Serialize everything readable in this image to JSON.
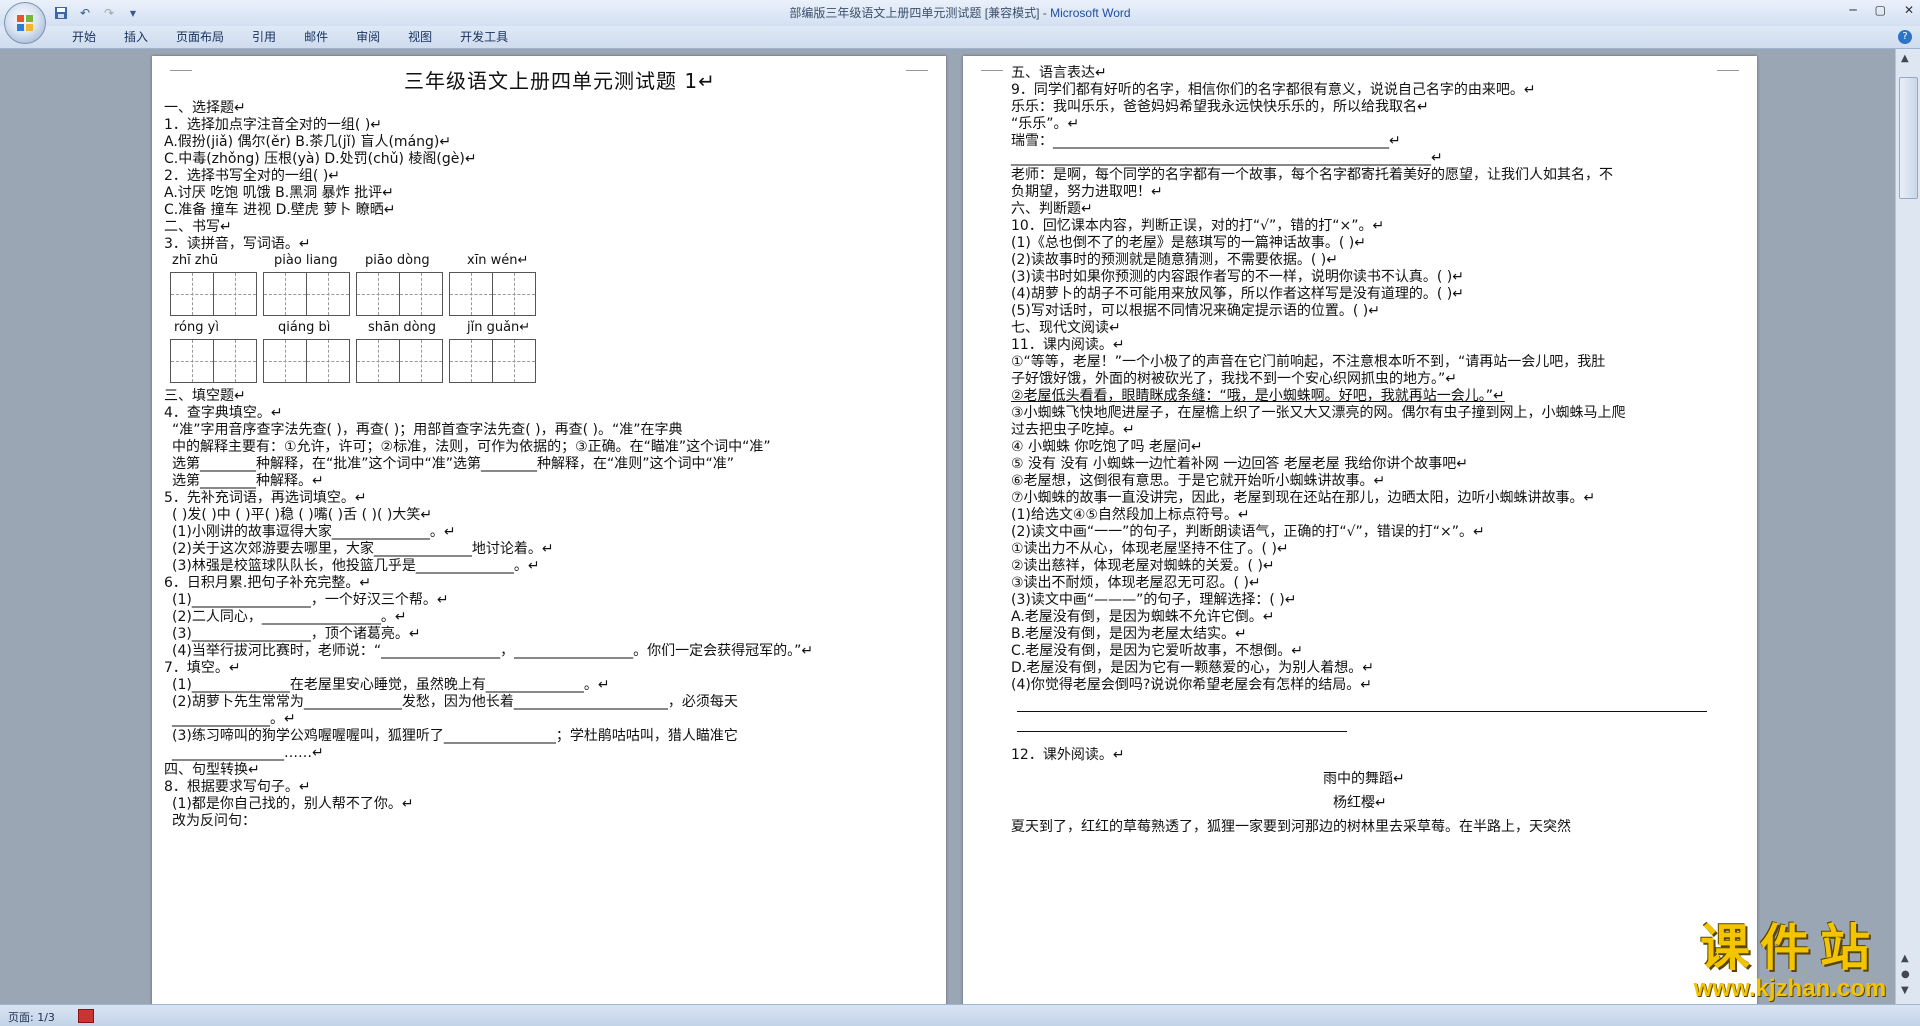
{
  "window": {
    "title": "部编版三年级语文上册四单元测试题 [兼容模式] - ",
    "app_name": "Microsoft Word",
    "qat_items": [
      "save-icon",
      "undo-icon",
      "redo-icon",
      "customize-icon"
    ]
  },
  "ribbon": {
    "tabs": [
      "开始",
      "插入",
      "页面布局",
      "引用",
      "邮件",
      "审阅",
      "视图",
      "开发工具"
    ]
  },
  "status": {
    "page_info": "页面: 1/3"
  },
  "watermark": {
    "text": "课件站",
    "url": "www.kjzhan.com"
  },
  "left_page": {
    "title": "三年级语文上册四单元测试题 1↵",
    "lines": [
      "一、选择题↵",
      "1．选择加点字注音全对的一组(  )↵",
      "A.假扮(jiǎ)     偶尔(ěr)     B.茶几(jǐ)     盲人(máng)↵",
      "C.中毒(zhǒng)   压根(yà)     D.处罚(chǔ)    棱阁(gè)↵",
      "2．选择书写全对的一组(  )↵",
      "A.讨厌   吃饱   叽饿      B.黑洞   暴炸   批评↵",
      "C.准备   撞车   进视      D.壁虎   萝卜   瞭晒↵",
      "二、书写↵",
      "3．读拼音，写词语。↵",
      "三、填空题↵",
      "4．查字典填空。↵",
      "“准”字用音序查字法先查(     )，再查(     )；用部首查字法先查(     )，再查(     )。“准”在字典",
      "中的解释主要有：①允许，许可；②标准，法则，可作为依据的；③正确。在“瞄准”这个词中“准”",
      "选第________种解释，在“批准”这个词中“准”选第________种解释，在“准则”这个词中“准”",
      "选第________种解释。↵",
      "5．先补充词语，再选词填空。↵",
      "(      )发(      )中      (      )平(      )稳      (      )嘴(      )舌      (      )(      )大笑↵",
      "(1)小刚讲的故事逗得大家______________。↵",
      "(2)关于这次郊游要去哪里，大家______________地讨论着。↵",
      "(3)林强是校篮球队队长，他投篮几乎是______________。↵",
      "6．日积月累.把句子补充完整。↵",
      "(1)_________________，一个好汉三个帮。↵",
      "(2)二人同心，_________________。↵",
      "(3)_________________，顶个诸葛亮。↵",
      "(4)当举行拔河比赛时，老师说：“_________________，_________________。你们一定会获得冠军的。”↵",
      "7．填空。↵",
      "(1)______________在老屋里安心睡觉，虽然晚上有______________。↵",
      "(2)胡萝卜先生常常为______________发愁，因为他长着______________________，必须每天",
      "______________。↵",
      "(3)练习啼叫的狗学公鸡喔喔喔叫，狐狸听了________________；学杜鹃咕咕叫，猎人瞄准它",
      "________________……↵",
      "四、句型转换↵",
      "8．根据要求写句子。↵",
      "(1)都是你自己找的，别人帮不了你。↵",
      "改为反问句："
    ],
    "pinyin_row1": [
      "zhī  zhū",
      "piào liang",
      "piāo dòng",
      "xīn  wén↵"
    ],
    "pinyin_row2": [
      "róng  yì",
      "qiáng  bì",
      "shān  dòng",
      "jǐn  guǎn↵"
    ]
  },
  "right_page": {
    "lines": [
      "五、语言表达↵",
      "9．同学们都有好听的名字，相信你们的名字都很有意义，说说自己名字的由来吧。↵",
      " 乐乐：我叫乐乐，爸爸妈妈希望我永远快快乐乐的，所以给我取名↵",
      " “乐乐”。↵",
      " 瑞雪：________________________________________________↵",
      "____________________________________________________________↵",
      " 老师：是啊，每个同学的名字都有一个故事，每个名字都寄托着美好的愿望，让我们人如其名，不",
      " 负期望，努力进取吧！↵",
      "六、判断题↵",
      "10．回忆课本内容，判断正误，对的打“√”，错的打“×”。↵",
      " (1)《总也倒不了的老屋》是慈琪写的一篇神话故事。(    )↵",
      " (2)读故事时的预测就是随意猜测，不需要依据。(      )↵",
      " (3)读书时如果你预测的内容跟作者写的不一样，说明你读书不认真。(    )↵",
      " (4)胡萝卜的胡子不可能用来放风筝，所以作者这样写是没有道理的。(    )↵",
      " (5)写对话时，可以根据不同情况来确定提示语的位置。(    )↵",
      "七、现代文阅读↵",
      "11．课内阅读。↵",
      "①“等等，老屋！”一个小极了的声音在它门前响起，不注意根本听不到，“请再站一会儿吧，我肚",
      "子好饿好饿，外面的树被砍光了，我找不到一个安心织网抓虫的地方。”↵",
      "②老屋低头看看，眼睛眯成条缝：“哦，是小蜘蛛啊。好吧，我就再站一会儿。”↵",
      "③小蜘蛛飞快地爬进屋子，在屋檐上织了一张又大又漂亮的网。偶尔有虫子撞到网上，小蜘蛛马上爬",
      "过去把虫子吃掉。↵",
      "④ 小蜘蛛   你吃饱了吗   老屋问↵",
      "⑤ 没有   没有   小蜘蛛一边忙着补网   一边回答  老屋老屋  我给你讲个故事吧↵",
      "⑥老屋想，这倒很有意思。于是它就开始听小蜘蛛讲故事。↵",
      "⑦小蜘蛛的故事一直没讲完，因此，老屋到现在还站在那儿，边晒太阳，边听小蜘蛛讲故事。↵",
      "(1)给选文④⑤自然段加上标点符号。↵",
      "(2)读文中画“一一”的句子，判断朗读语气，正确的打“√”，错误的打“×”。↵",
      "①读出力不从心，体现老屋坚持不住了。(      )↵",
      "②读出慈祥，体现老屋对蜘蛛的关爱。(    )↵",
      "③读出不耐烦，体现老屋忍无可忍。(    )↵",
      "(3)读文中画“———”的句子，理解选择：(    )↵",
      "A.老屋没有倒，是因为蜘蛛不允许它倒。↵",
      "B.老屋没有倒，是因为老屋太结实。↵",
      "C.老屋没有倒，是因为它爱听故事，不想倒。↵",
      "D.老屋没有倒，是因为它有一颗慈爱的心，为别人着想。↵",
      "(4)你觉得老屋会倒吗?说说你希望老屋会有怎样的结局。↵",
      "12．课外阅读。↵",
      "雨中的舞蹈↵",
      "杨红樱↵",
      "    夏天到了，红红的草莓熟透了，狐狸一家要到河那边的树林里去采草莓。在半路上，天突然"
    ]
  }
}
